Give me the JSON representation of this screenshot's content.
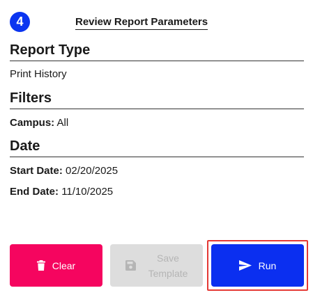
{
  "header": {
    "step_number": "4",
    "title": "Review Report Parameters"
  },
  "report_type": {
    "heading": "Report Type",
    "value": "Print History"
  },
  "filters": {
    "heading": "Filters",
    "campus_label": "Campus:",
    "campus_value": "All"
  },
  "date": {
    "heading": "Date",
    "start_label": "Start Date:",
    "start_value": "02/20/2025",
    "end_label": "End Date:",
    "end_value": "11/10/2025"
  },
  "actions": {
    "clear_label": "Clear",
    "save_label_line1": "Save",
    "save_label_line2": "Template",
    "run_label": "Run"
  },
  "icons": {
    "clear": "trash-icon",
    "save": "floppy-disk-icon",
    "run": "send-icon"
  },
  "colors": {
    "step_badge": "#0b35f0",
    "clear_button": "#f5055f",
    "save_button_disabled": "#dddddd",
    "run_button": "#0b2ff0",
    "run_highlight_outline": "#e53935"
  }
}
